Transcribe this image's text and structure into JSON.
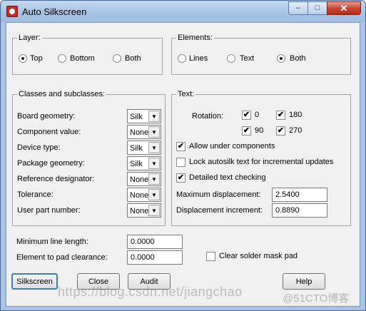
{
  "window": {
    "title": "Auto Silkscreen",
    "min_glyph": "–",
    "max_glyph": "□",
    "close_glyph": "✕"
  },
  "layer": {
    "title": "Layer:",
    "options": [
      {
        "label": "Top",
        "selected": true
      },
      {
        "label": "Bottom",
        "selected": false
      },
      {
        "label": "Both",
        "selected": false
      }
    ]
  },
  "elements": {
    "title": "Elements:",
    "options": [
      {
        "label": "Lines",
        "selected": false
      },
      {
        "label": "Text",
        "selected": false
      },
      {
        "label": "Both",
        "selected": true
      }
    ]
  },
  "classes": {
    "title": "Classes and subclasses:",
    "rows": [
      {
        "label": "Board geometry:",
        "value": "Silk"
      },
      {
        "label": "Component value:",
        "value": "None"
      },
      {
        "label": "Device type:",
        "value": "Silk"
      },
      {
        "label": "Package geometry:",
        "value": "Silk"
      },
      {
        "label": "Reference designator:",
        "value": "None"
      },
      {
        "label": "Tolerance:",
        "value": "None"
      },
      {
        "label": "User part number:",
        "value": "None"
      }
    ]
  },
  "text": {
    "title": "Text:",
    "rotation_label": "Rotation:",
    "rotations": [
      {
        "label": "0",
        "checked": true
      },
      {
        "label": "180",
        "checked": true
      },
      {
        "label": "90",
        "checked": true
      },
      {
        "label": "270",
        "checked": true
      }
    ],
    "allow_under": {
      "label": "Allow under components",
      "checked": true
    },
    "lock_autosilk": {
      "label": "Lock autosilk text for incremental updates",
      "checked": false
    },
    "detailed_check": {
      "label": "Detailed text checking",
      "checked": true
    },
    "max_disp_label": "Maximum displacement:",
    "max_disp_value": "2.5400",
    "disp_inc_label": "Displacement increment:",
    "disp_inc_value": "0.8890"
  },
  "bottom": {
    "min_line_label": "Minimum line length:",
    "min_line_value": "0.0000",
    "pad_clear_label": "Element to pad clearance:",
    "pad_clear_value": "0.0000",
    "clear_mask": {
      "label": "Clear solder mask pad",
      "checked": false
    }
  },
  "buttons": {
    "silkscreen": "Silkscreen",
    "close": "Close",
    "audit": "Audit",
    "help": "Help"
  },
  "check_glyph": "✔",
  "arrow_glyph": "▼",
  "watermark": "https://blog.csdn.net/jiangchao",
  "watermark2": "@51CTO博客"
}
